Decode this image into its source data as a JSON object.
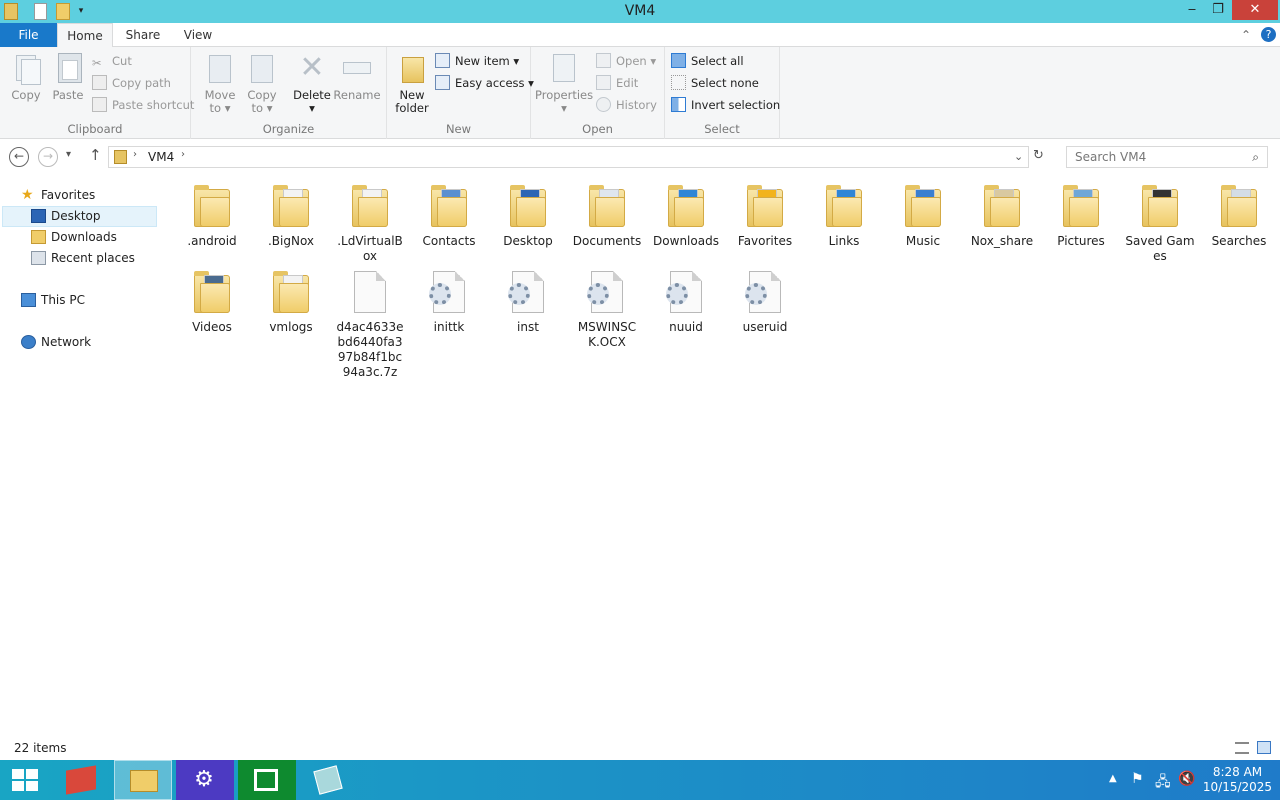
{
  "window": {
    "title": "VM4"
  },
  "tabs": {
    "file": "File",
    "home": "Home",
    "share": "Share",
    "view": "View"
  },
  "ribbon": {
    "clipboard": {
      "copy": "Copy",
      "paste": "Paste",
      "cut": "Cut",
      "copy_path": "Copy path",
      "paste_shortcut": "Paste shortcut",
      "label": "Clipboard"
    },
    "organize": {
      "move_to": "Move",
      "move_to2": "to",
      "copy_to": "Copy",
      "copy_to2": "to",
      "delete": "Delete",
      "rename": "Rename",
      "label": "Organize"
    },
    "new": {
      "new_folder": "New",
      "new_folder2": "folder",
      "new_item": "New item",
      "easy_access": "Easy access",
      "label": "New"
    },
    "open": {
      "properties": "Properties",
      "open": "Open",
      "edit": "Edit",
      "history": "History",
      "label": "Open"
    },
    "select": {
      "select_all": "Select all",
      "select_none": "Select none",
      "invert": "Invert selection",
      "label": "Select"
    }
  },
  "address": {
    "crumb": "VM4",
    "search_placeholder": "Search VM4"
  },
  "nav": {
    "favorites": "Favorites",
    "desktop": "Desktop",
    "downloads": "Downloads",
    "recent": "Recent places",
    "thispc": "This PC",
    "network": "Network"
  },
  "files": [
    {
      "name": ".android",
      "type": "folder"
    },
    {
      "name": ".BigNox",
      "type": "folder"
    },
    {
      "name": ".LdVirtualBox",
      "type": "folder"
    },
    {
      "name": "Contacts",
      "type": "folder"
    },
    {
      "name": "Desktop",
      "type": "folder"
    },
    {
      "name": "Documents",
      "type": "folder"
    },
    {
      "name": "Downloads",
      "type": "folder"
    },
    {
      "name": "Favorites",
      "type": "folder"
    },
    {
      "name": "Links",
      "type": "folder"
    },
    {
      "name": "Music",
      "type": "folder"
    },
    {
      "name": "Nox_share",
      "type": "folder"
    },
    {
      "name": "Pictures",
      "type": "folder"
    },
    {
      "name": "Saved Games",
      "type": "folder"
    },
    {
      "name": "Searches",
      "type": "folder"
    },
    {
      "name": "Videos",
      "type": "folder"
    },
    {
      "name": "vmlogs",
      "type": "folder"
    },
    {
      "name": "d4ac4633ebd6440fa397b84f1bc94a3c.7z",
      "type": "file"
    },
    {
      "name": "inittk",
      "type": "config"
    },
    {
      "name": "inst",
      "type": "config"
    },
    {
      "name": "MSWINSCK.OCX",
      "type": "config"
    },
    {
      "name": "nuuid",
      "type": "config"
    },
    {
      "name": "useruid",
      "type": "config"
    }
  ],
  "status": {
    "count": "22 items"
  },
  "taskbar": {
    "time": "8:28 AM",
    "date": "10/15/2025"
  }
}
